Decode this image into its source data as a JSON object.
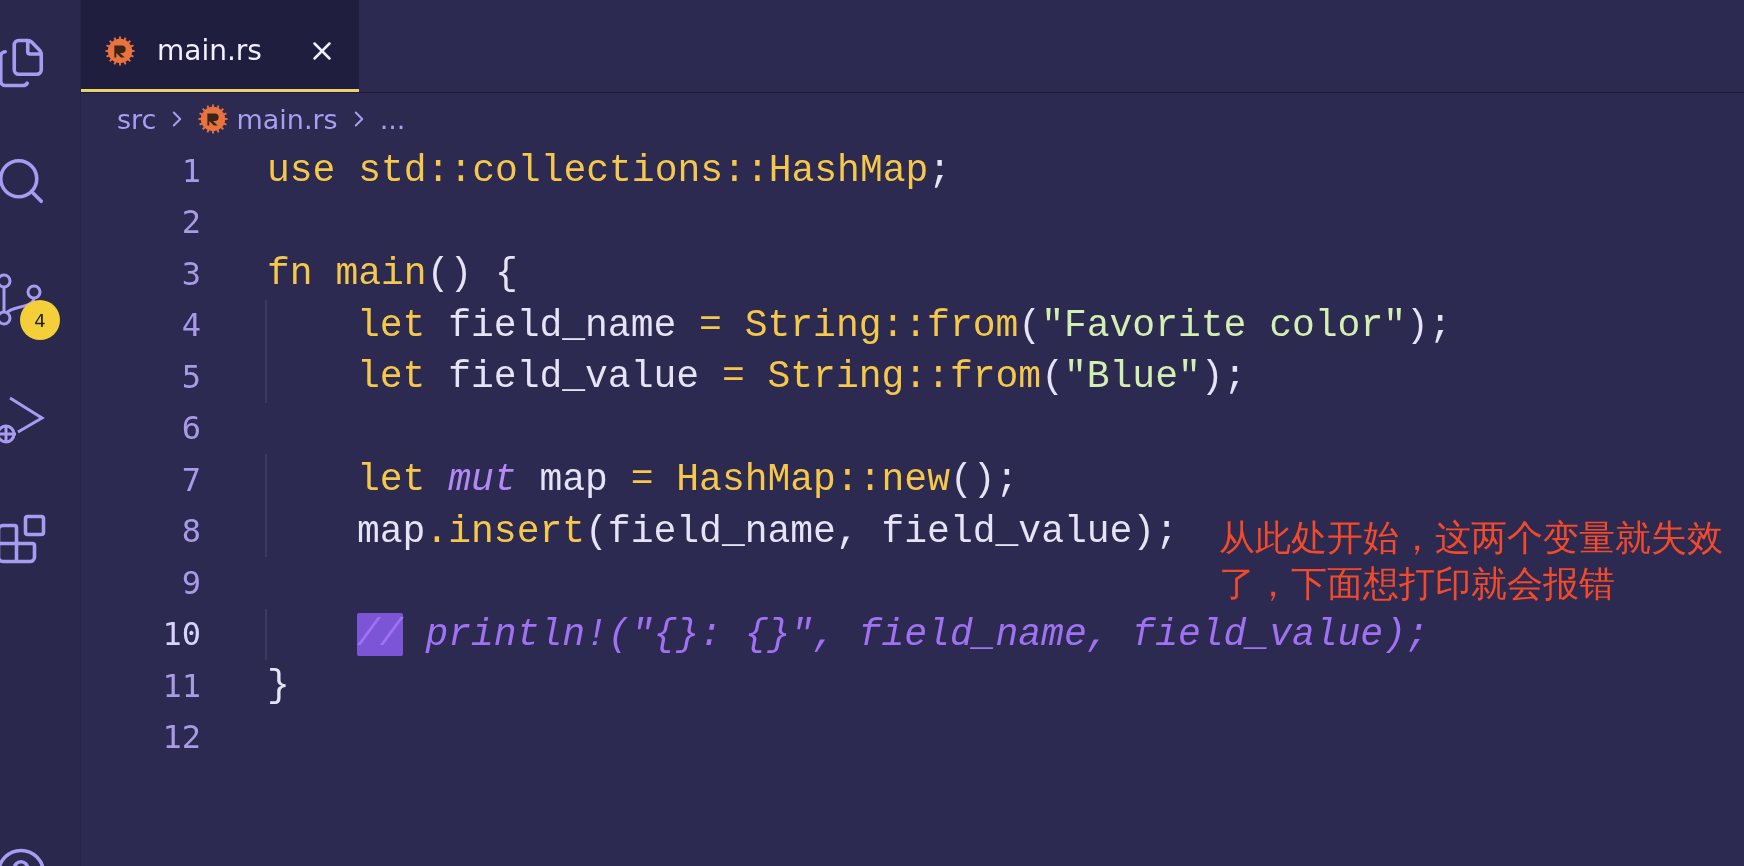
{
  "activity_bar": {
    "source_control_badge": "4"
  },
  "tabs": [
    {
      "label": "main.rs",
      "selected": true
    }
  ],
  "breadcrumb": [
    "src",
    "main.rs",
    "..."
  ],
  "editor": {
    "lines": [
      {
        "number": "1",
        "current": false,
        "indented": false,
        "tokens": [
          {
            "text": "use",
            "kind": "keyword"
          },
          {
            "text": " std::collections::HashMap",
            "kind": "type"
          },
          {
            "text": ";",
            "kind": "punct"
          }
        ]
      },
      {
        "number": "2",
        "current": false
      },
      {
        "number": "3",
        "current": false,
        "indented": false,
        "tokens": [
          {
            "text": "fn",
            "kind": "keyword"
          },
          {
            "text": " main",
            "kind": "type"
          },
          {
            "text": "() {",
            "kind": "punct"
          }
        ]
      },
      {
        "number": "4",
        "current": false,
        "indented": true,
        "tokens": [
          {
            "text": "let",
            "kind": "keyword"
          },
          {
            "text": " field_name ",
            "kind": "ident"
          },
          {
            "text": "=",
            "kind": "keyword"
          },
          {
            "text": " String::from",
            "kind": "type"
          },
          {
            "text": "(",
            "kind": "punct"
          },
          {
            "text": "\"Favorite color\"",
            "kind": "string"
          },
          {
            "text": ");",
            "kind": "punct"
          }
        ]
      },
      {
        "number": "5",
        "current": false,
        "indented": true,
        "tokens": [
          {
            "text": "let",
            "kind": "keyword"
          },
          {
            "text": " field_value ",
            "kind": "ident"
          },
          {
            "text": "=",
            "kind": "keyword"
          },
          {
            "text": " String::from",
            "kind": "type"
          },
          {
            "text": "(",
            "kind": "punct"
          },
          {
            "text": "\"Blue\"",
            "kind": "string"
          },
          {
            "text": ");",
            "kind": "punct"
          }
        ]
      },
      {
        "number": "6",
        "current": false
      },
      {
        "number": "7",
        "current": false,
        "indented": true,
        "tokens": [
          {
            "text": "let",
            "kind": "keyword"
          },
          {
            "text": " mut",
            "kind": "modifier"
          },
          {
            "text": " map ",
            "kind": "ident"
          },
          {
            "text": "=",
            "kind": "keyword"
          },
          {
            "text": " HashMap::new",
            "kind": "type"
          },
          {
            "text": "();",
            "kind": "punct"
          }
        ]
      },
      {
        "number": "8",
        "current": false,
        "indented": true,
        "tokens": [
          {
            "text": "map",
            "kind": "ident"
          },
          {
            "text": ".",
            "kind": "keyword"
          },
          {
            "text": "insert",
            "kind": "type"
          },
          {
            "text": "(field_name, field_value);",
            "kind": "ident"
          }
        ]
      },
      {
        "number": "9",
        "current": false
      },
      {
        "number": "10",
        "current": true,
        "indented": true,
        "tokens": [
          {
            "text": "//",
            "kind": "selection"
          },
          {
            "text": " println!(\"{}: {}\", field_name, field_value);",
            "kind": "comment"
          }
        ]
      },
      {
        "number": "11",
        "current": false,
        "indented": false,
        "tokens": [
          {
            "text": "}",
            "kind": "punct"
          }
        ]
      },
      {
        "number": "12",
        "current": false
      }
    ]
  },
  "annotation": "从此处开始，这两个变量就失效了，下面想打印就会报错"
}
